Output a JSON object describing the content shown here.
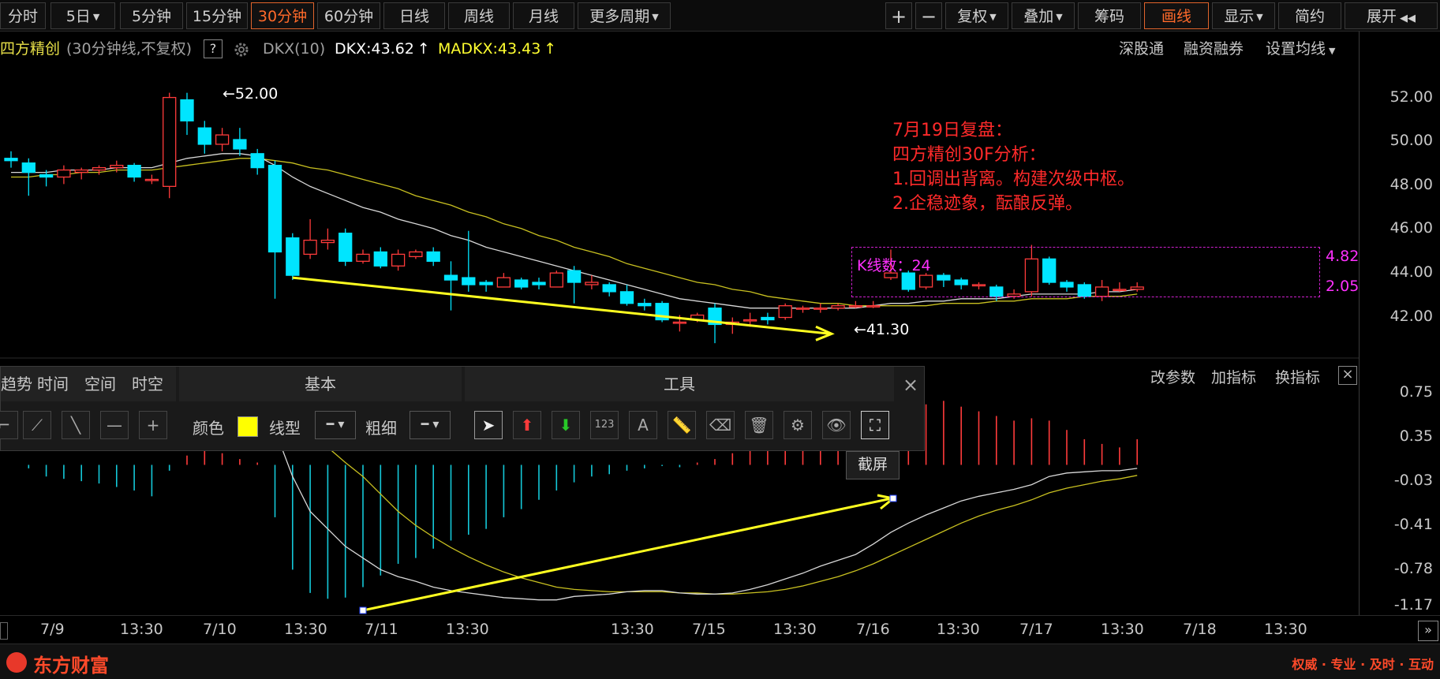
{
  "toolbar": {
    "periods": [
      "分时",
      "5日",
      "5分钟",
      "15分钟",
      "30分钟",
      "60分钟",
      "日线",
      "周线",
      "月线",
      "更多周期"
    ],
    "selected_period": "30分钟",
    "right_buttons": [
      "复权",
      "叠加",
      "筹码",
      "画线",
      "显示",
      "简约",
      "展开"
    ],
    "selected_right": "画线",
    "zoom_in": "+",
    "zoom_out": "−"
  },
  "info": {
    "stock_name": "四方精创",
    "chart_desc": "(30分钟线,不复权)",
    "help": "?",
    "indicator": "DKX(10)",
    "dkx": "DKX:43.62",
    "madkx": "MADKX:43.43",
    "right_links": [
      "深股通",
      "融资融券",
      "设置均线"
    ]
  },
  "annotation": {
    "title": "7月19日复盘：",
    "line1": "四方精创30F分析：",
    "line2": "1.回调出背离。构建次级中枢。",
    "line3": "2.企稳迹象，酝酿反弹。"
  },
  "box": {
    "label": "K线数：24",
    "top_value": "4.82",
    "bottom_value": "2.05"
  },
  "price_marks": {
    "high": "52.00",
    "low": "41.30"
  },
  "main_axis": [
    "52.00",
    "50.00",
    "48.00",
    "46.00",
    "44.00",
    "42.00"
  ],
  "sub_axis": [
    "0.75",
    "0.35",
    "-0.03",
    "-0.41",
    "-0.78",
    "-1.17"
  ],
  "sub_links": [
    "改参数",
    "加指标",
    "换指标"
  ],
  "dates": [
    "7/9",
    "13:30",
    "7/10",
    "13:30",
    "7/11",
    "13:30",
    "13:30",
    "7/15",
    "13:30",
    "7/16",
    "13:30",
    "7/17",
    "13:30",
    "7/18",
    "13:30"
  ],
  "drawpanel": {
    "tabs_left": [
      "趋势",
      "时间",
      "空间",
      "时空"
    ],
    "section_basic": "基本",
    "section_tools": "工具",
    "color_label": "颜色",
    "linetype_label": "线型",
    "thickness_label": "粗细",
    "tooltip": "截屏",
    "close": "×"
  },
  "footer": {
    "brand": "东方财富",
    "slogan": "权威 · 专业 · 及时 · 互动"
  },
  "colors": {
    "up": "#ff3b3b",
    "down": "#00e5ff",
    "accent": "#ff6a2a",
    "annotation": "#ff2a2a",
    "box": "#d020d0",
    "arrow": "#ffff20"
  },
  "chart_data": {
    "type": "candlestick",
    "ylim": [
      40.8,
      53.0
    ],
    "candles": [
      [
        49.2,
        49.1,
        49.5,
        48.8
      ],
      [
        49.0,
        48.6,
        49.2,
        47.6
      ],
      [
        48.5,
        48.4,
        48.7,
        48.0
      ],
      [
        48.4,
        48.7,
        48.9,
        48.1
      ],
      [
        48.6,
        48.7,
        48.8,
        48.3
      ],
      [
        48.7,
        48.8,
        48.9,
        48.5
      ],
      [
        48.8,
        48.9,
        49.1,
        48.6
      ],
      [
        48.9,
        48.4,
        49.0,
        48.2
      ],
      [
        48.3,
        48.3,
        48.5,
        48.1
      ],
      [
        48.0,
        51.8,
        52.0,
        47.5
      ],
      [
        51.7,
        50.8,
        52.0,
        50.2
      ],
      [
        50.5,
        49.8,
        50.8,
        49.4
      ],
      [
        49.8,
        50.2,
        50.5,
        49.5
      ],
      [
        50.0,
        49.6,
        50.5,
        49.3
      ],
      [
        49.4,
        48.8,
        49.6,
        48.5
      ],
      [
        48.9,
        45.2,
        49.1,
        43.2
      ],
      [
        45.8,
        44.2,
        46.0,
        44.0
      ],
      [
        45.1,
        45.7,
        46.6,
        44.9
      ],
      [
        45.6,
        45.7,
        46.2,
        45.3
      ],
      [
        46.0,
        44.8,
        46.2,
        44.6
      ],
      [
        44.8,
        45.1,
        45.3,
        44.7
      ],
      [
        45.2,
        44.6,
        45.4,
        44.5
      ],
      [
        44.6,
        45.1,
        45.3,
        44.4
      ],
      [
        45.0,
        45.2,
        45.3,
        44.9
      ],
      [
        45.2,
        44.8,
        45.4,
        44.6
      ],
      [
        44.2,
        44.0,
        44.8,
        42.7
      ],
      [
        44.1,
        43.8,
        46.1,
        43.5
      ],
      [
        43.9,
        43.8,
        44.0,
        43.5
      ],
      [
        43.7,
        44.1,
        44.3,
        43.7
      ],
      [
        44.0,
        43.7,
        44.1,
        43.6
      ],
      [
        43.9,
        43.8,
        44.1,
        43.6
      ],
      [
        43.7,
        44.3,
        44.4,
        43.7
      ],
      [
        44.4,
        43.9,
        44.6,
        43.0
      ],
      [
        43.8,
        43.9,
        44.2,
        43.6
      ],
      [
        43.8,
        43.5,
        43.9,
        43.3
      ],
      [
        43.5,
        43.0,
        43.8,
        42.9
      ],
      [
        43.0,
        42.9,
        43.2,
        42.7
      ],
      [
        43.0,
        42.3,
        43.1,
        42.2
      ],
      [
        42.2,
        42.2,
        42.5,
        41.8
      ],
      [
        42.3,
        42.5,
        42.6,
        42.2
      ],
      [
        42.8,
        42.1,
        43.0,
        41.3
      ],
      [
        42.1,
        42.2,
        42.4,
        41.7
      ],
      [
        42.3,
        42.3,
        42.6,
        42.0
      ],
      [
        42.4,
        42.3,
        42.6,
        42.1
      ],
      [
        42.4,
        42.9,
        43.0,
        42.3
      ],
      [
        42.8,
        42.8,
        42.9,
        42.6
      ],
      [
        42.8,
        42.8,
        43.0,
        42.6
      ],
      [
        42.8,
        42.9,
        43.0,
        42.7
      ],
      [
        42.9,
        42.9,
        43.1,
        42.8
      ],
      [
        42.9,
        42.9,
        43.1,
        42.8
      ],
      [
        44.1,
        44.3,
        45.3,
        44.0
      ],
      [
        44.3,
        43.6,
        44.4,
        43.5
      ],
      [
        43.7,
        44.2,
        44.3,
        43.6
      ],
      [
        44.2,
        44.0,
        44.3,
        43.7
      ],
      [
        44.0,
        43.8,
        44.1,
        43.6
      ],
      [
        43.8,
        43.8,
        43.9,
        43.6
      ],
      [
        43.7,
        43.3,
        43.8,
        43.1
      ],
      [
        43.3,
        43.4,
        43.6,
        43.2
      ],
      [
        43.5,
        44.9,
        45.5,
        43.3
      ],
      [
        44.9,
        43.9,
        45.0,
        43.8
      ],
      [
        43.9,
        43.7,
        44.0,
        43.5
      ],
      [
        43.8,
        43.3,
        43.9,
        43.2
      ],
      [
        43.3,
        43.7,
        44.0,
        43.1
      ],
      [
        43.6,
        43.6,
        43.9,
        43.5
      ],
      [
        43.6,
        43.7,
        43.9,
        43.5
      ]
    ],
    "ma_white": [
      48.6,
      48.6,
      48.6,
      48.7,
      48.7,
      48.7,
      48.8,
      48.8,
      48.8,
      49.0,
      49.2,
      49.3,
      49.4,
      49.4,
      49.3,
      48.9,
      48.4,
      48.0,
      47.7,
      47.4,
      47.1,
      46.9,
      46.6,
      46.4,
      46.2,
      45.9,
      45.7,
      45.4,
      45.2,
      45.0,
      44.8,
      44.6,
      44.4,
      44.2,
      44.0,
      43.8,
      43.6,
      43.4,
      43.2,
      43.1,
      43.0,
      42.9,
      42.8,
      42.8,
      42.8,
      42.8,
      42.8,
      42.8,
      42.8,
      42.9,
      43.0,
      43.0,
      43.1,
      43.1,
      43.2,
      43.2,
      43.2,
      43.3,
      43.4,
      43.4,
      43.4,
      43.4,
      43.5,
      43.5,
      43.6
    ],
    "ma_yellow": [
      48.4,
      48.4,
      48.5,
      48.5,
      48.6,
      48.6,
      48.7,
      48.7,
      48.7,
      48.8,
      48.9,
      49.0,
      49.1,
      49.2,
      49.2,
      49.1,
      49.0,
      48.8,
      48.7,
      48.5,
      48.3,
      48.1,
      47.9,
      47.6,
      47.4,
      47.2,
      46.9,
      46.7,
      46.4,
      46.2,
      45.9,
      45.7,
      45.4,
      45.2,
      45.0,
      44.7,
      44.5,
      44.3,
      44.1,
      43.9,
      43.8,
      43.6,
      43.5,
      43.3,
      43.2,
      43.1,
      43.0,
      43.0,
      42.9,
      42.9,
      42.9,
      42.9,
      42.9,
      43.0,
      43.0,
      43.0,
      43.1,
      43.1,
      43.2,
      43.2,
      43.2,
      43.3,
      43.3,
      43.3,
      43.4
    ],
    "sub_ylim": [
      -1.25,
      0.85
    ],
    "macd_bars": [
      0.0,
      -0.03,
      -0.1,
      -0.12,
      -0.14,
      -0.16,
      -0.19,
      -0.22,
      -0.27,
      -0.05,
      0.08,
      0.12,
      0.1,
      0.05,
      0.02,
      -0.45,
      -0.9,
      -1.1,
      -1.15,
      -1.14,
      -1.05,
      -0.95,
      -0.85,
      -0.8,
      -0.72,
      -0.65,
      -0.6,
      -0.55,
      -0.45,
      -0.38,
      -0.3,
      -0.22,
      -0.15,
      -0.1,
      -0.08,
      -0.05,
      -0.03,
      -0.01,
      -0.02,
      0.02,
      0.05,
      0.1,
      0.15,
      0.18,
      0.2,
      0.23,
      0.25,
      0.28,
      0.3,
      0.32,
      0.42,
      0.48,
      0.52,
      0.55,
      0.5,
      0.46,
      0.42,
      0.38,
      0.4,
      0.38,
      0.3,
      0.22,
      0.18,
      0.15,
      0.22
    ],
    "dif": [
      0.3,
      0.3,
      0.3,
      0.3,
      0.3,
      0.3,
      0.3,
      0.3,
      0.3,
      0.3,
      0.3,
      0.3,
      0.3,
      0.3,
      0.3,
      0.3,
      -0.1,
      -0.4,
      -0.55,
      -0.7,
      -0.8,
      -0.9,
      -0.96,
      -1.0,
      -1.05,
      -1.08,
      -1.1,
      -1.12,
      -1.14,
      -1.15,
      -1.16,
      -1.16,
      -1.13,
      -1.12,
      -1.11,
      -1.09,
      -1.08,
      -1.08,
      -1.1,
      -1.11,
      -1.11,
      -1.1,
      -1.07,
      -1.03,
      -0.98,
      -0.93,
      -0.87,
      -0.82,
      -0.77,
      -0.68,
      -0.58,
      -0.5,
      -0.43,
      -0.37,
      -0.31,
      -0.27,
      -0.24,
      -0.21,
      -0.17,
      -0.1,
      -0.07,
      -0.06,
      -0.05,
      -0.05,
      -0.03
    ],
    "dea": [
      0.5,
      0.5,
      0.5,
      0.5,
      0.5,
      0.5,
      0.5,
      0.5,
      0.5,
      0.5,
      0.5,
      0.5,
      0.5,
      0.5,
      0.5,
      0.5,
      0.4,
      0.28,
      0.15,
      0.02,
      -0.1,
      -0.25,
      -0.4,
      -0.52,
      -0.62,
      -0.71,
      -0.79,
      -0.86,
      -0.92,
      -0.97,
      -1.01,
      -1.05,
      -1.07,
      -1.08,
      -1.09,
      -1.09,
      -1.09,
      -1.09,
      -1.1,
      -1.1,
      -1.11,
      -1.11,
      -1.1,
      -1.09,
      -1.07,
      -1.04,
      -1.0,
      -0.96,
      -0.91,
      -0.85,
      -0.78,
      -0.71,
      -0.64,
      -0.57,
      -0.5,
      -0.44,
      -0.39,
      -0.35,
      -0.3,
      -0.24,
      -0.2,
      -0.17,
      -0.14,
      -0.12,
      -0.09
    ]
  }
}
